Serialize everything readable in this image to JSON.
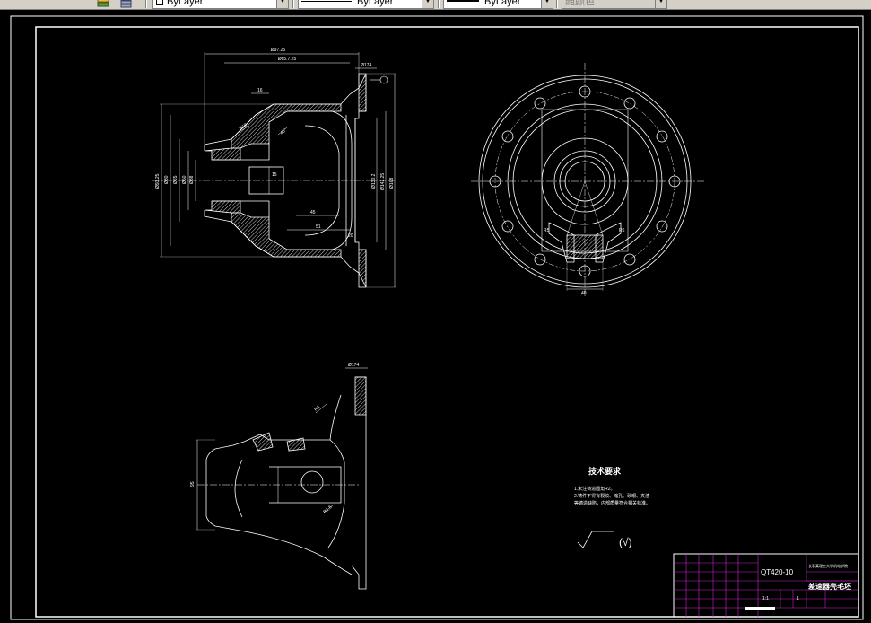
{
  "toolbar": {
    "layer_combo": {
      "value": "ByLayer"
    },
    "linetype_combo": {
      "value": "ByLayer"
    },
    "lineweight_combo": {
      "value": "ByLayer"
    },
    "plotstyle_combo": {
      "value": "随颜色"
    }
  },
  "drawing": {
    "tech_req_title": "技术要求",
    "tech_req_items": [
      "1.未注铸造圆角R2。",
      "2.铸件不得有裂纹、缩孔、砂眼、夹渣",
      "等铸造缺陷，内部质量符合相关标准。"
    ],
    "roughness_symbol": "(√)",
    "dimensions": {
      "front_top1": "Ø97.25",
      "front_top2": "Ø85.7.25",
      "front_flange_top": "Ø174",
      "front_left1": "Ø93.25",
      "front_left2": "Ø80",
      "front_left3": "Ø65",
      "front_left4": "Ø50",
      "front_left5": "Ø38",
      "front_right1": "Ø130.2",
      "front_right2": "Ø142.25",
      "front_right3": "Ø168",
      "front_small1": "16",
      "front_small2": "R10",
      "front_small3": "45",
      "front_small4": "51",
      "front_small5": "15",
      "front_small6": "20",
      "front_small7": "45°",
      "side_width": "40",
      "side_note1": "R5",
      "side_note2": "R6",
      "section_top": "Ø174",
      "section_left": "95",
      "section_note1": "R3",
      "section_note2": "R1.5"
    },
    "title_block": {
      "material": "QT420-10",
      "part_name": "差速器壳毛坯",
      "school": "长春某理工大学机电学院",
      "scale": "1:1",
      "sheet": "1"
    }
  }
}
